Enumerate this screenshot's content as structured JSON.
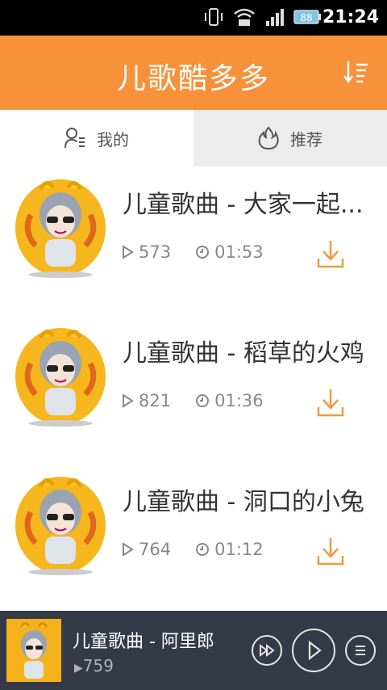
{
  "status_bar": {
    "time": "21:24",
    "icons": [
      "vibrate-icon",
      "wifi-icon",
      "signal-icon",
      "battery-icon"
    ],
    "battery_label": "88"
  },
  "app_bar": {
    "title": "儿歌酷多多",
    "sort_icon": "sort-icon"
  },
  "tabs": [
    {
      "label": "我的",
      "icon": "user-list-icon",
      "active": true
    },
    {
      "label": "推荐",
      "icon": "flame-icon",
      "active": false
    }
  ],
  "songs": [
    {
      "title": "儿童歌曲 - 大家一起...",
      "plays": "573",
      "duration": "01:53"
    },
    {
      "title": "儿童歌曲 - 稻草的火鸡",
      "plays": "821",
      "duration": "01:36"
    },
    {
      "title": "儿童歌曲 - 洞口的小兔",
      "plays": "764",
      "duration": "01:12"
    }
  ],
  "player": {
    "title": "儿童歌曲 - 阿里郎",
    "plays": "759",
    "controls": [
      "fast-forward-icon",
      "play-icon",
      "menu-icon"
    ]
  },
  "colors": {
    "accent": "#f7913a",
    "player_bg": "#343a48",
    "tab_inactive_bg": "#ececec"
  }
}
